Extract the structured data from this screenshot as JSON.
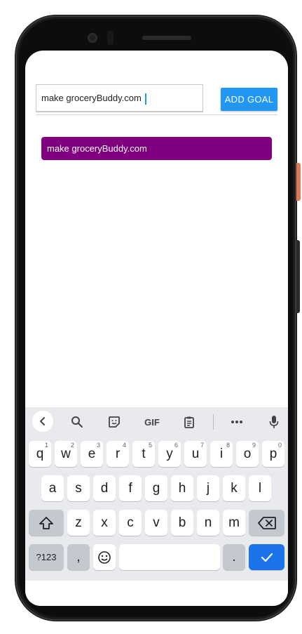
{
  "app": {
    "input_value": "make groceryBuddy.com",
    "add_button_label": "ADD GOAL",
    "goals": [
      "make groceryBuddy.com"
    ],
    "colors": {
      "button": "#2196f3",
      "goal_item": "#800080",
      "cursor": "#1ea0c0"
    }
  },
  "keyboard": {
    "toolbar": {
      "back_icon": "chevron-left-icon",
      "search_icon": "search-icon",
      "sticker_icon": "sticker-icon",
      "gif_label": "GIF",
      "clipboard_icon": "clipboard-icon",
      "more_icon": "more-icon",
      "mic_icon": "microphone-icon"
    },
    "row1": [
      {
        "k": "q",
        "h": "1"
      },
      {
        "k": "w",
        "h": "2"
      },
      {
        "k": "e",
        "h": "3"
      },
      {
        "k": "r",
        "h": "4"
      },
      {
        "k": "t",
        "h": "5"
      },
      {
        "k": "y",
        "h": "6"
      },
      {
        "k": "u",
        "h": "7"
      },
      {
        "k": "i",
        "h": "8"
      },
      {
        "k": "o",
        "h": "9"
      },
      {
        "k": "p",
        "h": "0"
      }
    ],
    "row2": [
      "a",
      "s",
      "d",
      "f",
      "g",
      "h",
      "j",
      "k",
      "l"
    ],
    "row3": [
      "z",
      "x",
      "c",
      "v",
      "b",
      "n",
      "m"
    ],
    "symbols_label": "?123",
    "comma": ",",
    "period": ".",
    "shift_icon": "shift-icon",
    "backspace_icon": "backspace-icon",
    "emoji_icon": "emoji-icon",
    "enter_icon": "checkmark-icon"
  }
}
